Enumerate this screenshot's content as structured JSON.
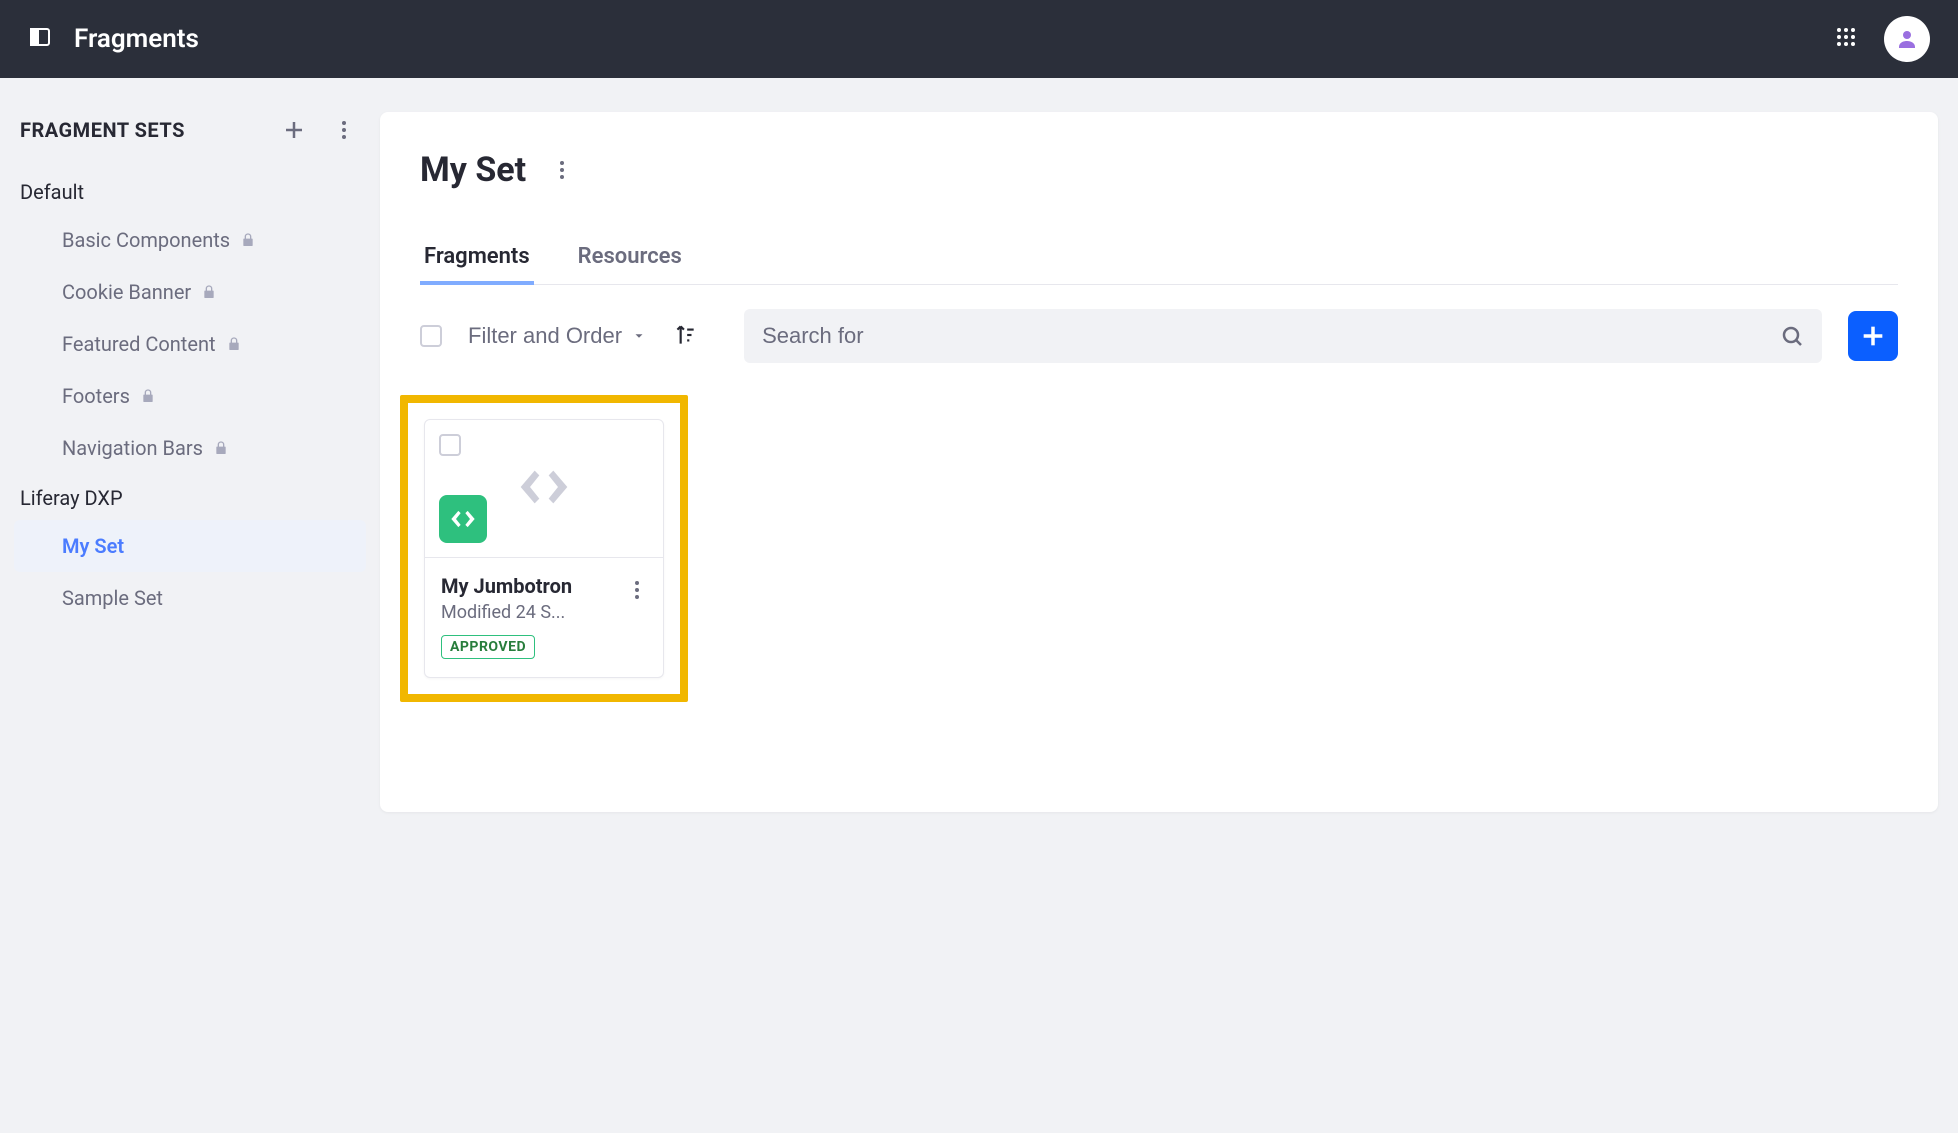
{
  "topbar": {
    "title": "Fragments"
  },
  "sidebar": {
    "title": "FRAGMENT SETS",
    "groups": [
      {
        "label": "Default",
        "items": [
          {
            "label": "Basic Components",
            "locked": true,
            "active": false
          },
          {
            "label": "Cookie Banner",
            "locked": true,
            "active": false
          },
          {
            "label": "Featured Content",
            "locked": true,
            "active": false
          },
          {
            "label": "Footers",
            "locked": true,
            "active": false
          },
          {
            "label": "Navigation Bars",
            "locked": true,
            "active": false
          }
        ]
      },
      {
        "label": "Liferay DXP",
        "items": [
          {
            "label": "My Set",
            "locked": false,
            "active": true
          },
          {
            "label": "Sample Set",
            "locked": false,
            "active": false
          }
        ]
      }
    ]
  },
  "main": {
    "title": "My Set",
    "tabs": [
      {
        "label": "Fragments",
        "active": true
      },
      {
        "label": "Resources",
        "active": false
      }
    ],
    "filter_label": "Filter and Order",
    "search_placeholder": "Search for",
    "cards": [
      {
        "title": "My Jumbotron",
        "subtitle": "Modified 24 S...",
        "status": "APPROVED"
      }
    ]
  }
}
